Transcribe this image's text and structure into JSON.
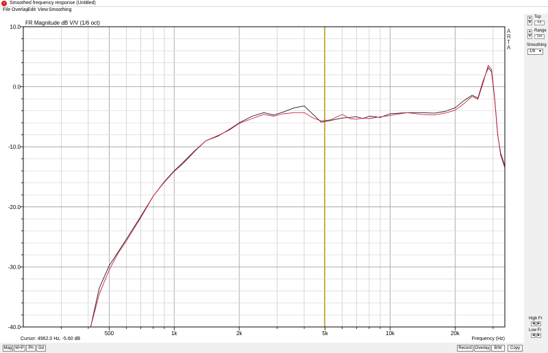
{
  "window": {
    "title": "Smoothed frequency response (Untitled)",
    "menu": [
      "File",
      "Overlay",
      "Edit",
      "View",
      "Smoothing"
    ]
  },
  "right_panel": {
    "top_label": "Top",
    "fit_label": "Fit",
    "range_label": "Range",
    "set_label": "Set",
    "smoothing_label": "Smoothing",
    "smoothing_value": "1/6",
    "high_fr_label": "High Fr",
    "low_fr_label": "Low Fr"
  },
  "bottom": {
    "left_buttons": [
      "Mag",
      "M+P",
      "Ph",
      "Gd"
    ],
    "right_buttons": [
      "Record",
      "Overlay",
      "B/W",
      "Copy"
    ]
  },
  "chart_data": {
    "type": "line",
    "title": "FR Magnitude dB V/V (1/6 oct)",
    "watermark": [
      "A",
      "R",
      "T",
      "A"
    ],
    "xlabel": "Frequency (Hz)",
    "ylabel": "",
    "x_scale": "log",
    "xlim": [
      200,
      34000
    ],
    "ylim": [
      -40,
      10
    ],
    "x_tick_labels": [
      {
        "value": 500,
        "label": "500"
      },
      {
        "value": 1000,
        "label": "1k"
      },
      {
        "value": 2000,
        "label": "2k"
      },
      {
        "value": 5000,
        "label": "5k"
      },
      {
        "value": 10000,
        "label": "10k"
      },
      {
        "value": 20000,
        "label": "20k"
      }
    ],
    "y_ticks": [
      {
        "value": 10,
        "label": "10.0"
      },
      {
        "value": 0,
        "label": "0.0"
      },
      {
        "value": -10,
        "label": "-10.0"
      },
      {
        "value": -20,
        "label": "-20.0"
      },
      {
        "value": -30,
        "label": "-30.0"
      },
      {
        "value": -40,
        "label": "-40.0"
      }
    ],
    "grid": true,
    "cursor": {
      "frequency": 4962,
      "text": "Cursor: 4962.0 Hz, -5.60 dB",
      "color": "#e0b000"
    },
    "series": [
      {
        "color": "#1a1a1a",
        "points": [
          [
            410,
            -40.0
          ],
          [
            450,
            -33.5
          ],
          [
            500,
            -29.8
          ],
          [
            550,
            -27.5
          ],
          [
            600,
            -25.4
          ],
          [
            700,
            -21.6
          ],
          [
            800,
            -18.2
          ],
          [
            900,
            -15.8
          ],
          [
            1000,
            -14.0
          ],
          [
            1100,
            -12.6
          ],
          [
            1250,
            -10.6
          ],
          [
            1400,
            -9.0
          ],
          [
            1600,
            -8.2
          ],
          [
            1800,
            -7.1
          ],
          [
            2000,
            -6.0
          ],
          [
            2300,
            -4.9
          ],
          [
            2600,
            -4.3
          ],
          [
            2900,
            -4.7
          ],
          [
            3200,
            -4.2
          ],
          [
            3600,
            -3.5
          ],
          [
            4000,
            -3.2
          ],
          [
            4400,
            -4.6
          ],
          [
            4800,
            -5.9
          ],
          [
            5300,
            -5.6
          ],
          [
            6000,
            -5.2
          ],
          [
            7000,
            -5.0
          ],
          [
            7500,
            -5.3
          ],
          [
            8000,
            -4.9
          ],
          [
            9000,
            -5.1
          ],
          [
            10000,
            -4.5
          ],
          [
            12000,
            -4.3
          ],
          [
            14000,
            -4.3
          ],
          [
            16000,
            -4.4
          ],
          [
            18000,
            -4.1
          ],
          [
            20000,
            -3.5
          ],
          [
            22000,
            -2.3
          ],
          [
            24000,
            -1.4
          ],
          [
            25500,
            -1.9
          ],
          [
            27000,
            1.0
          ],
          [
            28500,
            3.2
          ],
          [
            29500,
            2.5
          ],
          [
            30500,
            -2.0
          ],
          [
            31500,
            -8.0
          ],
          [
            32500,
            -11.0
          ],
          [
            34000,
            -13.2
          ]
        ]
      },
      {
        "color": "#d81c3c",
        "points": [
          [
            410,
            -40.0
          ],
          [
            450,
            -34.5
          ],
          [
            500,
            -30.5
          ],
          [
            550,
            -27.7
          ],
          [
            600,
            -25.7
          ],
          [
            700,
            -21.8
          ],
          [
            800,
            -18.2
          ],
          [
            900,
            -15.9
          ],
          [
            1000,
            -14.1
          ],
          [
            1100,
            -12.8
          ],
          [
            1250,
            -10.7
          ],
          [
            1400,
            -9.0
          ],
          [
            1600,
            -8.1
          ],
          [
            1800,
            -7.2
          ],
          [
            2000,
            -6.1
          ],
          [
            2300,
            -5.3
          ],
          [
            2600,
            -4.6
          ],
          [
            2900,
            -4.9
          ],
          [
            3200,
            -4.5
          ],
          [
            3600,
            -4.3
          ],
          [
            4000,
            -4.3
          ],
          [
            4400,
            -5.2
          ],
          [
            4800,
            -5.7
          ],
          [
            5300,
            -5.5
          ],
          [
            6000,
            -4.6
          ],
          [
            6500,
            -5.3
          ],
          [
            7000,
            -5.4
          ],
          [
            7500,
            -5.2
          ],
          [
            8000,
            -5.3
          ],
          [
            9000,
            -5.0
          ],
          [
            10000,
            -4.8
          ],
          [
            12000,
            -4.3
          ],
          [
            14000,
            -4.6
          ],
          [
            16000,
            -4.7
          ],
          [
            18000,
            -4.4
          ],
          [
            20000,
            -3.9
          ],
          [
            22000,
            -2.8
          ],
          [
            24000,
            -1.6
          ],
          [
            25500,
            -2.1
          ],
          [
            27000,
            0.7
          ],
          [
            28500,
            3.6
          ],
          [
            29500,
            2.9
          ],
          [
            30500,
            -1.8
          ],
          [
            31500,
            -7.8
          ],
          [
            32500,
            -11.4
          ],
          [
            34000,
            -13.5
          ]
        ]
      }
    ]
  }
}
